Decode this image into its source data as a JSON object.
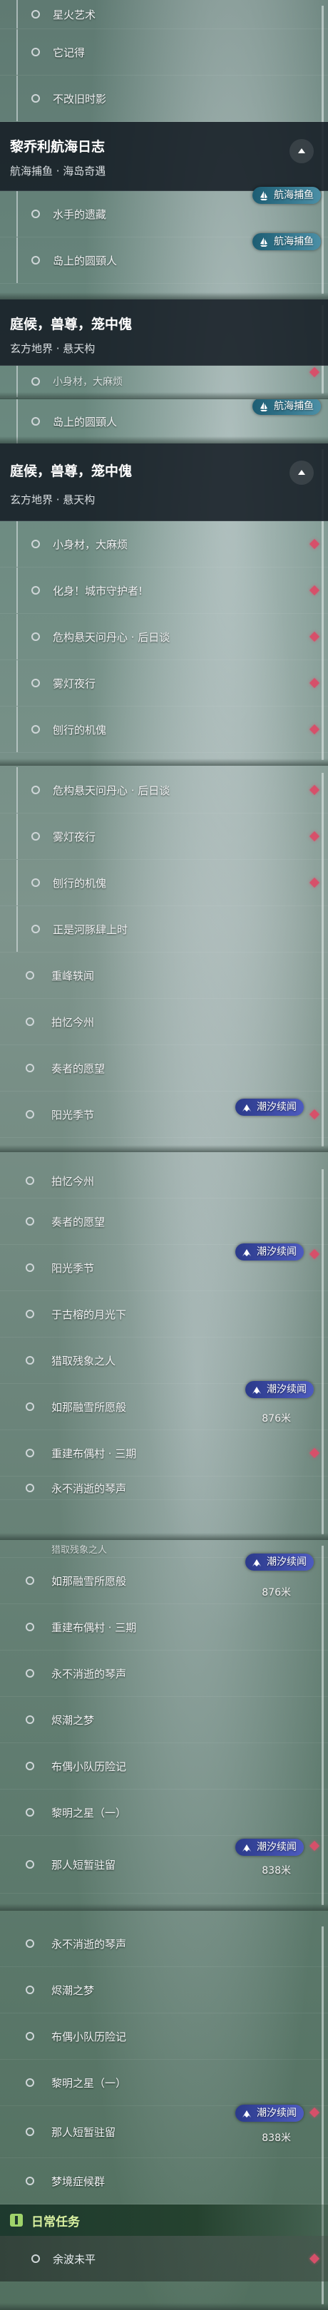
{
  "tags": {
    "chaoxi": "潮汐续闻",
    "hanghai": "航海捕鱼"
  },
  "icons": {
    "diamond": "red-diamond-marker",
    "ring": "hollow-circle",
    "collapse": "chevron-up-icon"
  },
  "colors": {
    "diamond": "#d6506a",
    "tag_purple": "#3d4bb0",
    "header": "#141c24",
    "daily_accent": "#9fd36a"
  },
  "shot1": {
    "items": [
      "星火艺术",
      "它记得",
      "不改旧时影"
    ],
    "header": {
      "title": "黎乔利航海日志",
      "subtitle": "航海捕鱼 · 海岛奇遇"
    },
    "items2": [
      "水手的遗藏",
      "岛上的圆頸人"
    ]
  },
  "shot2": {
    "header": {
      "title": "庭候，兽尊，笼中傀",
      "subtitle": "玄方地界 · 悬天构"
    },
    "partial": "小身材，大麻烦",
    "items": [
      "岛上的圆頸人"
    ]
  },
  "shot3": {
    "header": {
      "title": "庭候，兽尊，笼中傀",
      "subtitle": "玄方地界 · 悬天构"
    },
    "items": [
      "小身材，大麻烦",
      "化身！城市守护者!",
      "危构悬天问丹心 · 后日谈",
      "雾灯夜行",
      "刨行的机傀"
    ]
  },
  "shot4": {
    "sub_items": [
      "危构悬天问丹心 · 后日谈",
      "雾灯夜行",
      "刨行的机傀",
      "正是河豚肆上时"
    ],
    "top_items": [
      "重峰轶闻",
      "拍忆今州",
      "奏者的愿望",
      "阳光季节"
    ]
  },
  "shot5": {
    "items": [
      "拍忆今州",
      "奏者的愿望",
      "阳光季节",
      "于古榕的月光下",
      "猎取残象之人",
      "如那融雪所愿般",
      "重建布偶村 · 三期",
      "永不消逝的琴声"
    ],
    "dist": "876米"
  },
  "shot6": {
    "partial": "猎取残象之人",
    "items": [
      "如那融雪所愿般",
      "重建布偶村 · 三期",
      "永不消逝的琴声",
      "烬潮之梦",
      "布偶小队历险记",
      "黎明之星（一）",
      "那人短暂驻留"
    ],
    "dist1": "876米",
    "dist2": "838米"
  },
  "shot7": {
    "items": [
      "永不消逝的琴声",
      "烬潮之梦",
      "布偶小队历险记",
      "黎明之星（一）",
      "那人短暂驻留",
      "梦境症候群"
    ],
    "dist": "838米",
    "daily_title": "日常任务",
    "daily_item": "余波未平"
  }
}
